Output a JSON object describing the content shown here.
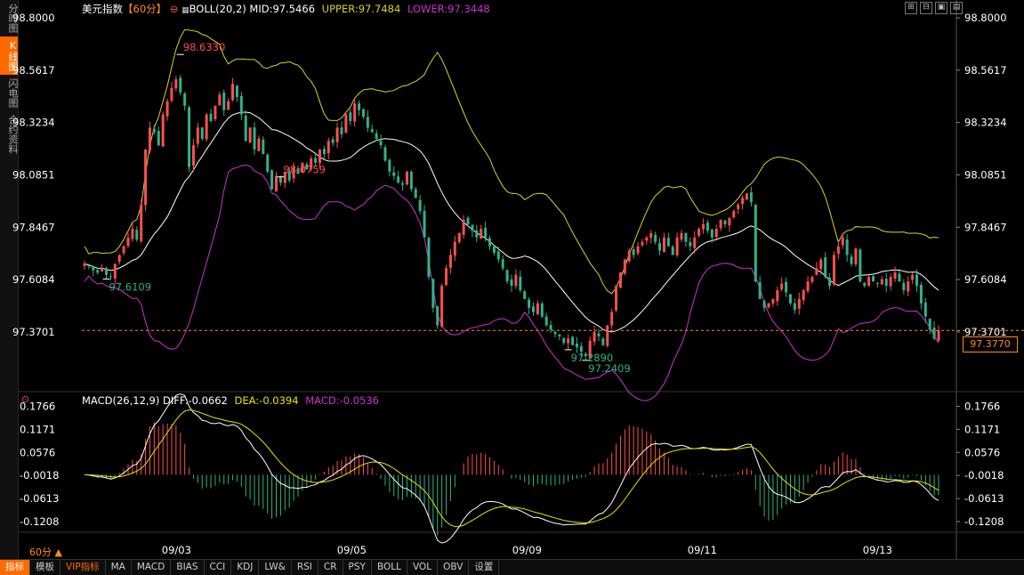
{
  "left_rail": [
    {
      "label": "分时图",
      "active": false
    },
    {
      "label": "K线图",
      "active": true
    },
    {
      "label": "闪电图",
      "active": false
    },
    {
      "label": "合约资料",
      "active": false
    }
  ],
  "header": {
    "symbol": "美元指数",
    "period": "【60分】",
    "boll_label": "BOLL(20,2)",
    "mid": "MID:97.5466",
    "upper": "UPPER:97.7484",
    "lower": "LOWER:97.3448"
  },
  "macd_header": {
    "label": "MACD(26,12,9)",
    "diff": "DIFF:-0.0662",
    "dea": "DEA:-0.0394",
    "macd": "MACD:-0.0536"
  },
  "colors": {
    "up": "#ff4f4f",
    "down": "#2fb28b",
    "upper": "#d8d22a",
    "mid": "#ffffff",
    "lower": "#cc33cc",
    "dea": "#e8e000",
    "macd": "#cc33cc",
    "accent": "#ff8c1a"
  },
  "price_tag": "97.3770",
  "period_label": "60分 ▲",
  "bottom_tabs": [
    "指标",
    "模板",
    "VIP指标",
    "MA",
    "MACD",
    "BIAS",
    "CCI",
    "KDJ",
    "LW&",
    "RSI",
    "CR",
    "PSY",
    "BOLL",
    "VOL",
    "OBV",
    "设置"
  ],
  "window_controls": [
    "⊞",
    "⊟",
    "▣",
    "▤"
  ],
  "chart_data": [
    {
      "type": "candlestick",
      "title": "美元指数 60分",
      "ylim": [
        97.24,
        98.8
      ],
      "y_ticks": [
        "98.8000",
        "98.5617",
        "98.3234",
        "98.0851",
        "97.8467",
        "97.6084",
        "97.3701"
      ],
      "x_ticks": [
        "09/03",
        "09/05",
        "09/09",
        "09/11",
        "09/13"
      ],
      "annotations": [
        {
          "text": "98.6330",
          "value": 98.633,
          "kind": "high"
        },
        {
          "text": "97.6109",
          "value": 97.6109,
          "kind": "low"
        },
        {
          "text": "98.0759",
          "value": 98.0759,
          "kind": "high"
        },
        {
          "text": "97.2409",
          "value": 97.2409,
          "kind": "low"
        },
        {
          "text": "97.2890",
          "value": 97.289,
          "kind": "low"
        }
      ],
      "reference_line": {
        "value": 97.377,
        "label": "97.3770"
      },
      "closes": [
        97.68,
        97.67,
        97.65,
        97.64,
        97.66,
        97.63,
        97.62,
        97.68,
        97.72,
        97.76,
        97.8,
        97.84,
        97.79,
        97.95,
        98.2,
        98.3,
        98.28,
        98.22,
        98.36,
        98.42,
        98.48,
        98.52,
        98.46,
        98.4,
        98.12,
        98.22,
        98.3,
        98.25,
        98.36,
        98.33,
        98.4,
        98.45,
        98.38,
        98.42,
        98.5,
        98.44,
        98.36,
        98.24,
        98.3,
        98.2,
        98.25,
        98.18,
        98.1,
        98.02,
        98.08,
        98.05,
        98.1,
        98.06,
        98.12,
        98.09,
        98.14,
        98.11,
        98.16,
        98.14,
        98.2,
        98.18,
        98.24,
        98.23,
        98.3,
        98.27,
        98.36,
        98.33,
        98.41,
        98.38,
        98.35,
        98.3,
        98.28,
        98.25,
        98.22,
        98.15,
        98.1,
        98.08,
        98.05,
        98.04,
        98.1,
        98.02,
        97.98,
        97.92,
        97.8,
        97.62,
        97.48,
        97.4,
        97.58,
        97.66,
        97.72,
        97.78,
        97.82,
        97.88,
        97.86,
        97.83,
        97.8,
        97.84,
        97.8,
        97.76,
        97.73,
        97.7,
        97.66,
        97.6,
        97.58,
        97.63,
        97.56,
        97.52,
        97.48,
        97.46,
        97.5,
        97.44,
        97.4,
        97.38,
        97.36,
        97.35,
        97.32,
        97.34,
        97.31,
        97.3,
        97.28,
        97.26,
        97.33,
        97.37,
        97.35,
        97.31,
        97.4,
        97.46,
        97.58,
        97.64,
        97.7,
        97.74,
        97.72,
        97.76,
        97.78,
        97.8,
        97.82,
        97.78,
        97.74,
        97.8,
        97.76,
        97.72,
        97.8,
        97.82,
        97.78,
        97.76,
        97.8,
        97.84,
        97.86,
        97.83,
        97.8,
        97.84,
        97.88,
        97.86,
        97.89,
        97.92,
        97.95,
        97.98,
        98.0,
        97.96,
        97.6,
        97.52,
        97.48,
        97.5,
        97.52,
        97.56,
        97.59,
        97.55,
        97.5,
        97.47,
        97.52,
        97.56,
        97.6,
        97.62,
        97.66,
        97.7,
        97.62,
        97.58,
        97.72,
        97.76,
        97.8,
        97.72,
        97.68,
        97.75,
        97.6,
        97.58,
        97.62,
        97.6,
        97.59,
        97.61,
        97.58,
        97.62,
        97.64,
        97.6,
        97.56,
        97.6,
        97.63,
        97.58,
        97.5,
        97.44,
        97.38,
        97.34,
        97.377
      ],
      "bands": {
        "upper_desc": "upper band",
        "mid_desc": "mid band",
        "lower_desc": "lower band"
      }
    },
    {
      "type": "macd",
      "ylim": [
        -0.13,
        0.18
      ],
      "y_ticks": [
        "0.1766",
        "0.1171",
        "0.0576",
        "-0.0018",
        "-0.0613",
        "-0.1208"
      ]
    }
  ]
}
